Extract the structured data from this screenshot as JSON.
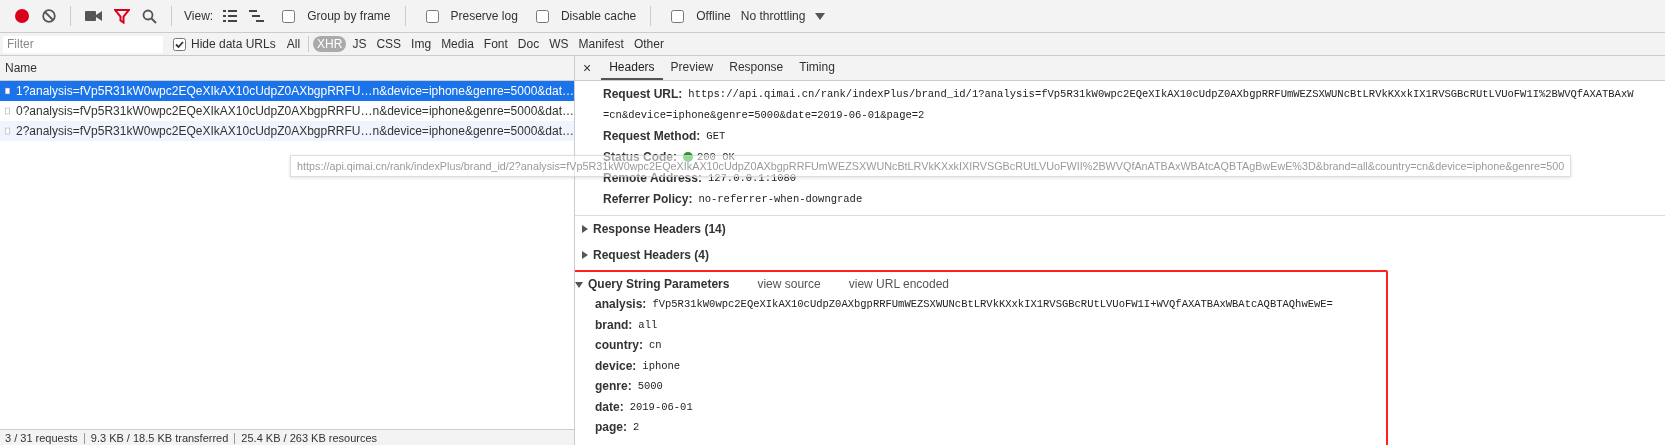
{
  "toolbar": {
    "view_label": "View:",
    "checkboxes": [
      {
        "label": "Group by frame",
        "checked": false
      },
      {
        "label": "Preserve log",
        "checked": false
      },
      {
        "label": "Disable cache",
        "checked": false
      },
      {
        "label": "Offline",
        "checked": false
      }
    ],
    "throttling": "No throttling"
  },
  "filter_bar": {
    "filter": {
      "placeholder": "Filter"
    },
    "hide_data_urls": {
      "label": "Hide data URLs",
      "checked": true
    },
    "types": [
      {
        "label": "All",
        "selected": false
      },
      {
        "label": "XHR",
        "selected": true
      },
      {
        "label": "JS",
        "selected": false
      },
      {
        "label": "CSS",
        "selected": false
      },
      {
        "label": "Img",
        "selected": false
      },
      {
        "label": "Media",
        "selected": false
      },
      {
        "label": "Font",
        "selected": false
      },
      {
        "label": "Doc",
        "selected": false
      },
      {
        "label": "WS",
        "selected": false
      },
      {
        "label": "Manifest",
        "selected": false
      },
      {
        "label": "Other",
        "selected": false
      }
    ]
  },
  "requests": {
    "column": "Name",
    "rows": [
      {
        "name": "1?analysis=fVp5R31kW0wpc2EQeXIkAX10cUdpZ0AXbgpRRFU…n&device=iphone&genre=5000&dat…",
        "selected": true
      },
      {
        "name": "0?analysis=fVp5R31kW0wpc2EQeXIkAX10cUdpZ0AXbgpRRFU…n&device=iphone&genre=5000&dat…",
        "selected": false
      },
      {
        "name": "2?analysis=fVp5R31kW0wpc2EQeXIkAX10cUdpZ0AXbgpRRFU…n&device=iphone&genre=5000&dat…",
        "selected": false
      }
    ]
  },
  "tooltip": "https://api.qimai.cn/rank/indexPlus/brand_id/2?analysis=fVp5R31kW0wpc2EQeXIkAX10cUdpZ0AXbgpRRFUmWEZSXWUNcBtLRVkKXxkIXIRVSGBcRUtLVUoFWII%2BWVQfAnATBAxWBAtcAQBTAgBwEwE%3D&brand=all&country=cn&device=iphone&genre=500",
  "details": {
    "close": "×",
    "tabs": [
      {
        "label": "Headers",
        "selected": true
      },
      {
        "label": "Preview",
        "selected": false
      },
      {
        "label": "Response",
        "selected": false
      },
      {
        "label": "Timing",
        "selected": false
      }
    ],
    "general": [
      {
        "kind": "url",
        "label": "Request URL:",
        "lines": [
          "https://api.qimai.cn/rank/indexPlus/brand_id/1?analysis=fVp5R31kW0wpc2EQeXIkAX10cUdpZ0AXbgpRRFUmWEZSXWUNcBtLRVkKXxkIX1RVSGBcRUtLVUoFW1I%2BWVQfAXATBAxW",
          "=cn&device=iphone&genre=5000&date=2019-06-01&page=2"
        ]
      },
      {
        "kind": "plain",
        "label": "Request Method:",
        "value": "GET"
      },
      {
        "kind": "status",
        "label": "Status Code:",
        "value": "200 OK"
      },
      {
        "kind": "plain",
        "label": "Remote Address:",
        "value": "127.0.0.1:1080"
      },
      {
        "kind": "plain",
        "label": "Referrer Policy:",
        "value": "no-referrer-when-downgrade"
      }
    ],
    "sections": [
      {
        "label": "Response Headers (14)",
        "expanded": false
      },
      {
        "label": "Request Headers (4)",
        "expanded": false
      }
    ],
    "query": {
      "label": "Query String Parameters",
      "expanded": true,
      "links": [
        "view source",
        "view URL encoded"
      ],
      "params": [
        {
          "name": "analysis:",
          "value": "fVp5R31kW0wpc2EQeXIkAX10cUdpZ0AXbgpRRFUmWEZSXWUNcBtLRVkKXxkIX1RVSGBcRUtLVUoFW1I+WVQfAXATBAxWBAtcAQBTAQhwEwE="
        },
        {
          "name": "brand:",
          "value": "all"
        },
        {
          "name": "country:",
          "value": "cn"
        },
        {
          "name": "device:",
          "value": "iphone"
        },
        {
          "name": "genre:",
          "value": "5000"
        },
        {
          "name": "date:",
          "value": "2019-06-01"
        },
        {
          "name": "page:",
          "value": "2"
        }
      ]
    }
  },
  "status_bar": [
    "3 / 31 requests",
    "9.3 KB / 18.5 KB transferred",
    "25.4 KB / 263 KB resources"
  ]
}
